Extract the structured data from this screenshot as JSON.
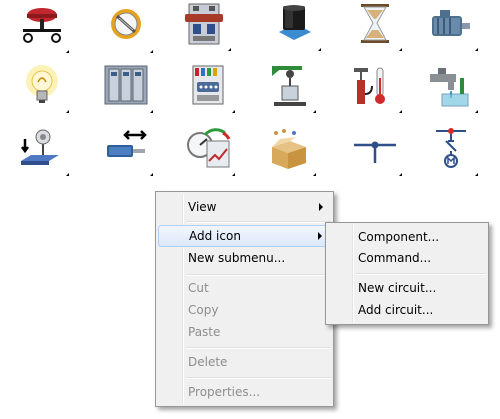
{
  "icons": [
    {
      "name": "pushbutton-icon"
    },
    {
      "name": "flow-meter-icon"
    },
    {
      "name": "relay-module-icon"
    },
    {
      "name": "transformer-icon"
    },
    {
      "name": "hourglass-icon"
    },
    {
      "name": "electric-motor-icon"
    },
    {
      "name": "light-bulb-icon"
    },
    {
      "name": "control-cabinet-icon"
    },
    {
      "name": "connector-icon"
    },
    {
      "name": "hoist-icon"
    },
    {
      "name": "thermometer-icon"
    },
    {
      "name": "faucet-icon"
    },
    {
      "name": "sensor-icon"
    },
    {
      "name": "cylinder-icon"
    },
    {
      "name": "gauge-icon"
    },
    {
      "name": "boxes-icon"
    },
    {
      "name": "tee-junction-icon"
    },
    {
      "name": "motor-switch-icon"
    }
  ],
  "context_menu": {
    "items": [
      {
        "label": "View",
        "submenu": true,
        "disabled": false
      },
      {
        "label": "Add icon",
        "submenu": true,
        "disabled": false,
        "highlighted": true
      },
      {
        "label": "New submenu...",
        "disabled": false
      },
      {
        "label": "Cut",
        "disabled": true
      },
      {
        "label": "Copy",
        "disabled": true
      },
      {
        "label": "Paste",
        "disabled": true
      },
      {
        "label": "Delete",
        "disabled": true
      },
      {
        "label": "Properties...",
        "disabled": true
      }
    ]
  },
  "submenu": {
    "items": [
      {
        "label": "Component..."
      },
      {
        "label": "Command..."
      },
      {
        "label": "New circuit..."
      },
      {
        "label": "Add circuit..."
      }
    ]
  },
  "colors": {
    "menu_bg": "#f0f0f0",
    "menu_border": "#979797",
    "highlight_border": "#aecff7",
    "disabled_text": "#8d8d8d"
  }
}
